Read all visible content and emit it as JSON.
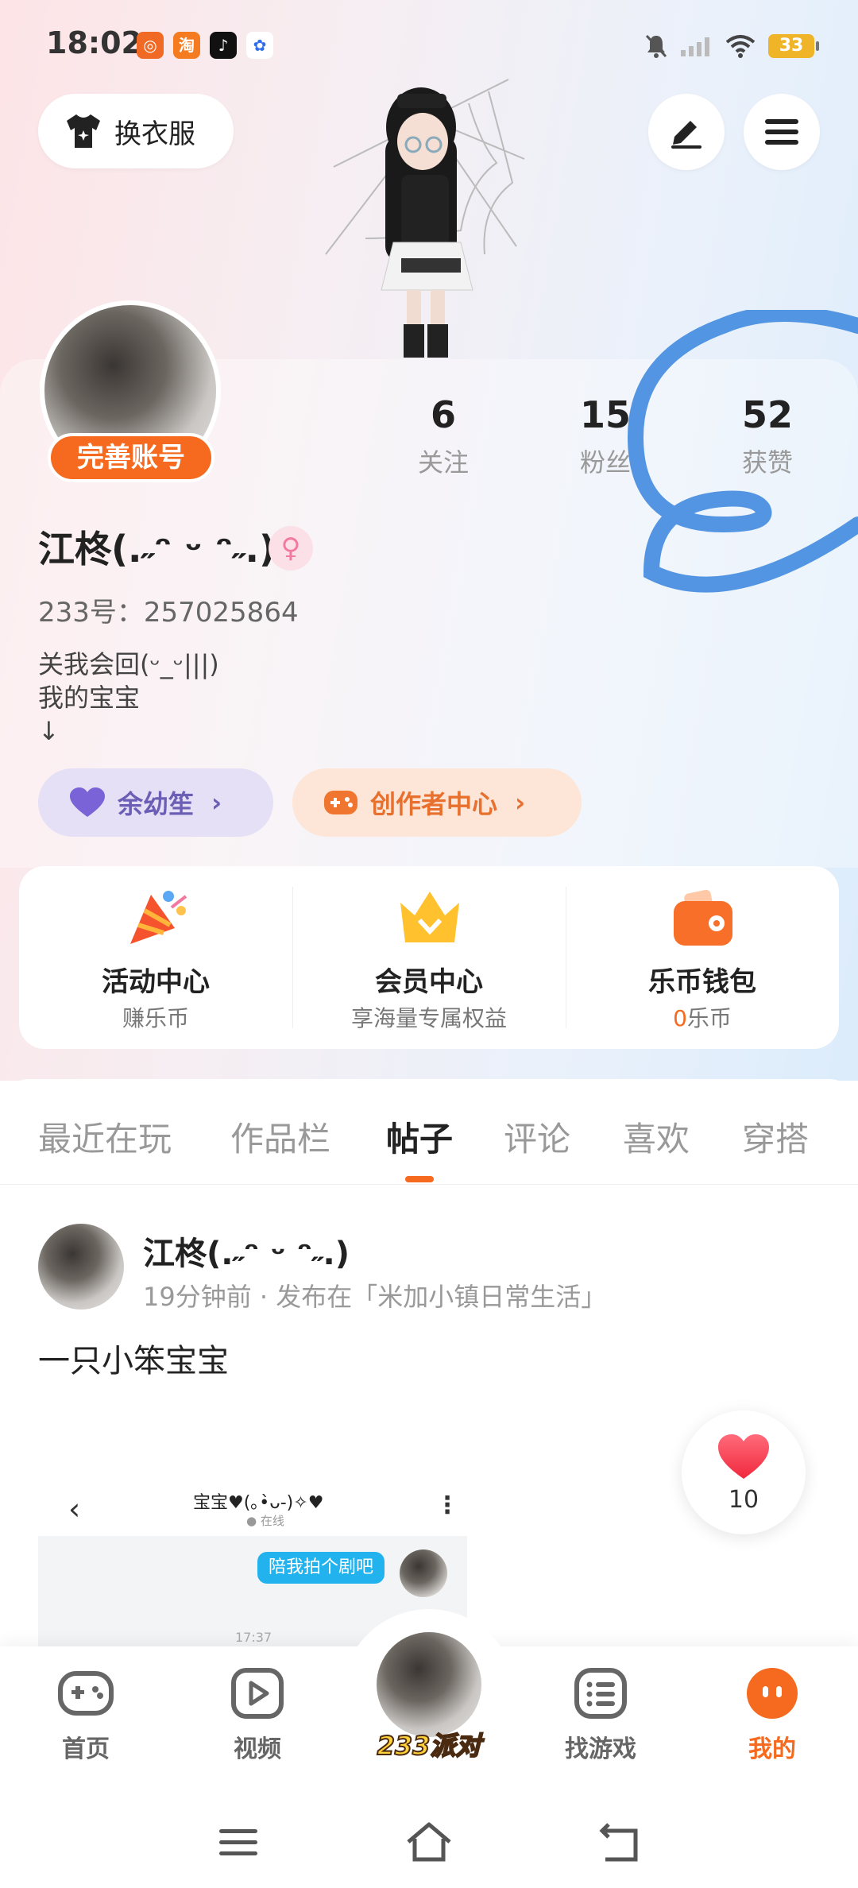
{
  "status_bar": {
    "time": "18:02",
    "app_icons": [
      "app-icon-orange",
      "taobao-icon",
      "tiktok-icon",
      "baidu-icon"
    ],
    "battery": "33"
  },
  "top_actions": {
    "change_outfit_label": "换衣服"
  },
  "profile": {
    "improve_account_label": "完善账号",
    "username": "江柊(.˶ᵔ ᵕ ᵔ˶.)",
    "uid": "233号：257025864",
    "bio": "关我会回(ᵕ_ᵕ|||)\n我的宝宝\n↓",
    "stats": [
      {
        "value": "6",
        "label": "关注"
      },
      {
        "value": "15",
        "label": "粉丝"
      },
      {
        "value": "52",
        "label": "获赞"
      }
    ],
    "pills": [
      {
        "label": "余幼笙",
        "chevron": "›"
      },
      {
        "label": "创作者中心",
        "chevron": "›"
      }
    ]
  },
  "features": [
    {
      "title": "活动中心",
      "subtitle": "赚乐币"
    },
    {
      "title": "会员中心",
      "subtitle": "享海量专属权益"
    },
    {
      "title": "乐币钱包",
      "subtitle_count": "0",
      "subtitle_unit": "乐币"
    }
  ],
  "tabs": [
    "最近在玩",
    "作品栏",
    "帖子",
    "评论",
    "喜欢",
    "穿搭"
  ],
  "active_tab": "帖子",
  "post": {
    "author": "江柊(.˶ᵔ ᵕ ᵔ˶.)",
    "meta": "19分钟前 · 发布在「米加小镇日常生活」",
    "text": "一只小笨宝宝",
    "image": {
      "back": "‹",
      "title": "宝宝♥(｡•̀ᴗ-)✧♥",
      "online": "● 在线",
      "more": "⋮",
      "bubble": "陪我拍个剧吧",
      "time": "17:37"
    },
    "likes": "10"
  },
  "bottom_nav": {
    "items": [
      "首页",
      "视频",
      "233派对",
      "找游戏",
      "我的"
    ],
    "active": "我的"
  },
  "colors": {
    "accent": "#f56a1e",
    "purple_pill": "#e6e0f6",
    "orange_pill": "#fde6d8",
    "stroke_blue": "#4a8fe0"
  }
}
